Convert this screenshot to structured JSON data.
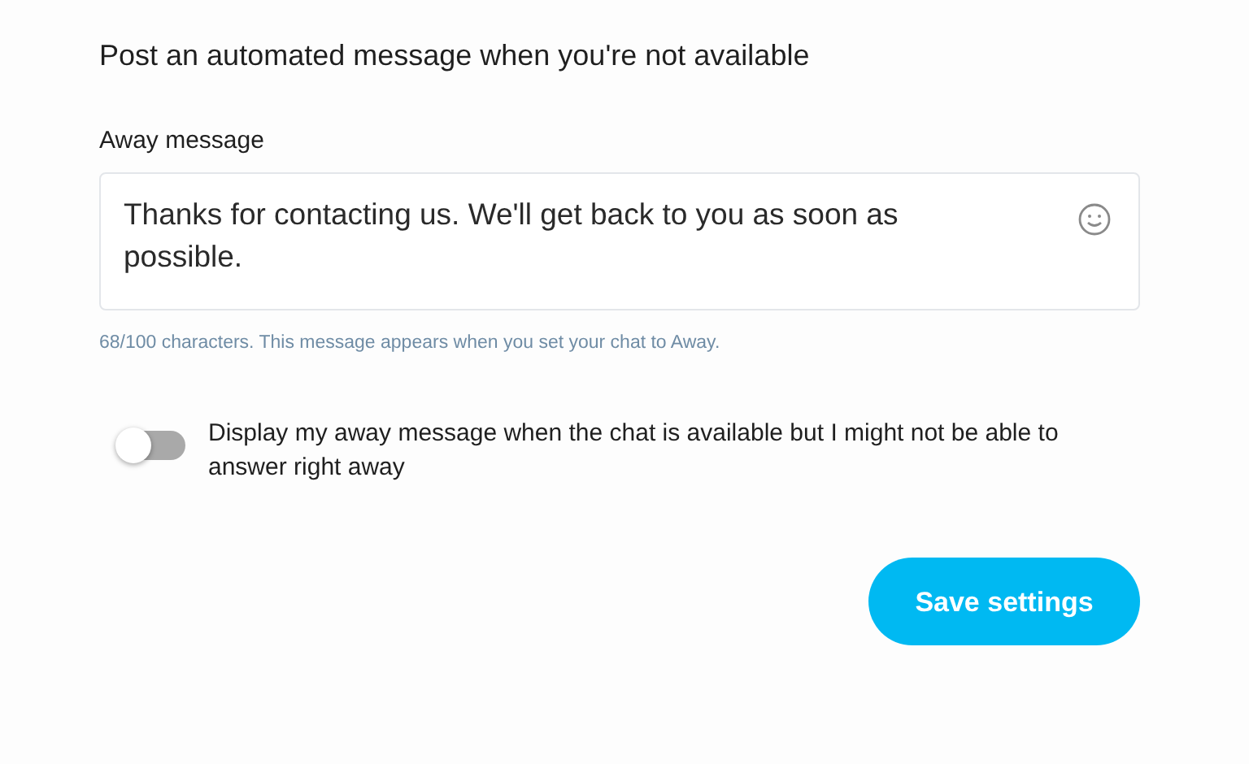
{
  "heading": "Post an automated message when you're not available",
  "away_message": {
    "label": "Away message",
    "value": "Thanks for contacting us. We'll get back to you as soon as possible.",
    "help": "68/100 characters. This message appears when you set your chat to Away."
  },
  "toggle": {
    "label": "Display my away message when the chat is available but I might not be able to answer right away",
    "on": false
  },
  "buttons": [
    "Save settings"
  ]
}
